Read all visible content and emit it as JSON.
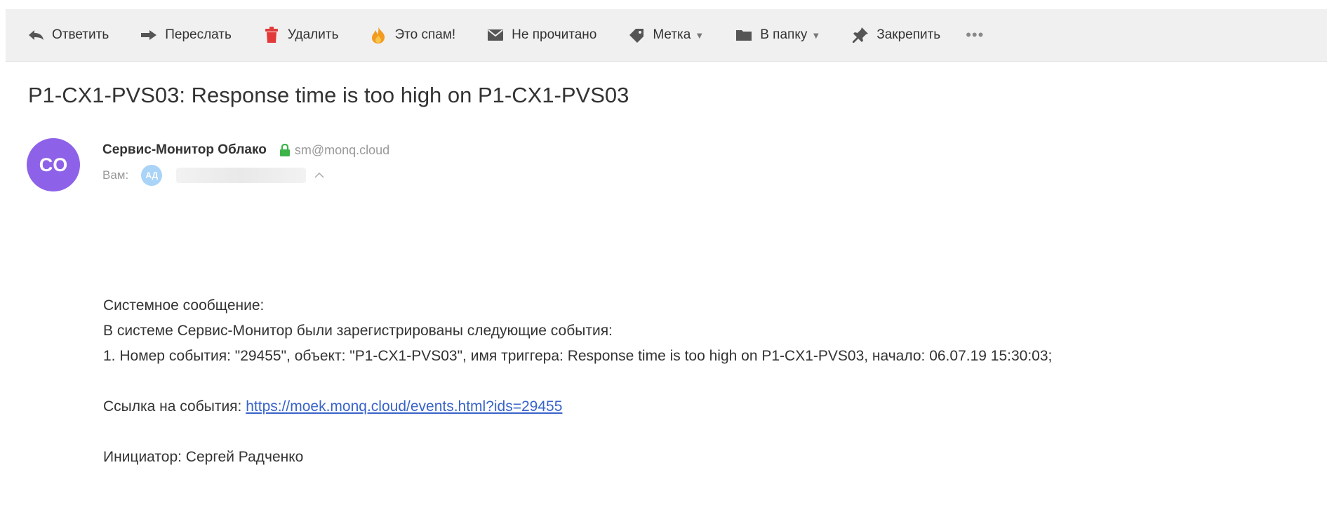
{
  "toolbar": {
    "reply": "Ответить",
    "forward": "Переслать",
    "delete": "Удалить",
    "spam": "Это спам!",
    "unread": "Не прочитано",
    "label": "Метка",
    "folder": "В папку",
    "pin": "Закрепить",
    "more": "•••"
  },
  "subject": "P1-CX1-PVS03: Response time is too high on P1-CX1-PVS03",
  "sender": {
    "initials": "CO",
    "name": "Сервис-Монитор Облако",
    "email": "sm@monq.cloud",
    "avatar_color": "#8e62e8"
  },
  "recipient": {
    "label": "Вам:",
    "initials": "АД",
    "avatar_color": "#a9d3f7"
  },
  "body": {
    "line1": "Системное сообщение:",
    "line2": "В системе Сервис-Монитор были зарегистрированы следующие события:",
    "line3": "1. Номер события: \"29455\", объект: \"P1-CX1-PVS03\", имя триггера: Response time is too high on P1-CX1-PVS03, начало: 06.07.19 15:30:03;",
    "link_prefix": "Ссылка на события: ",
    "link_text": "https://moek.monq.cloud/events.html?ids=29455",
    "initiator": "Инициатор: Сергей Радченко"
  }
}
